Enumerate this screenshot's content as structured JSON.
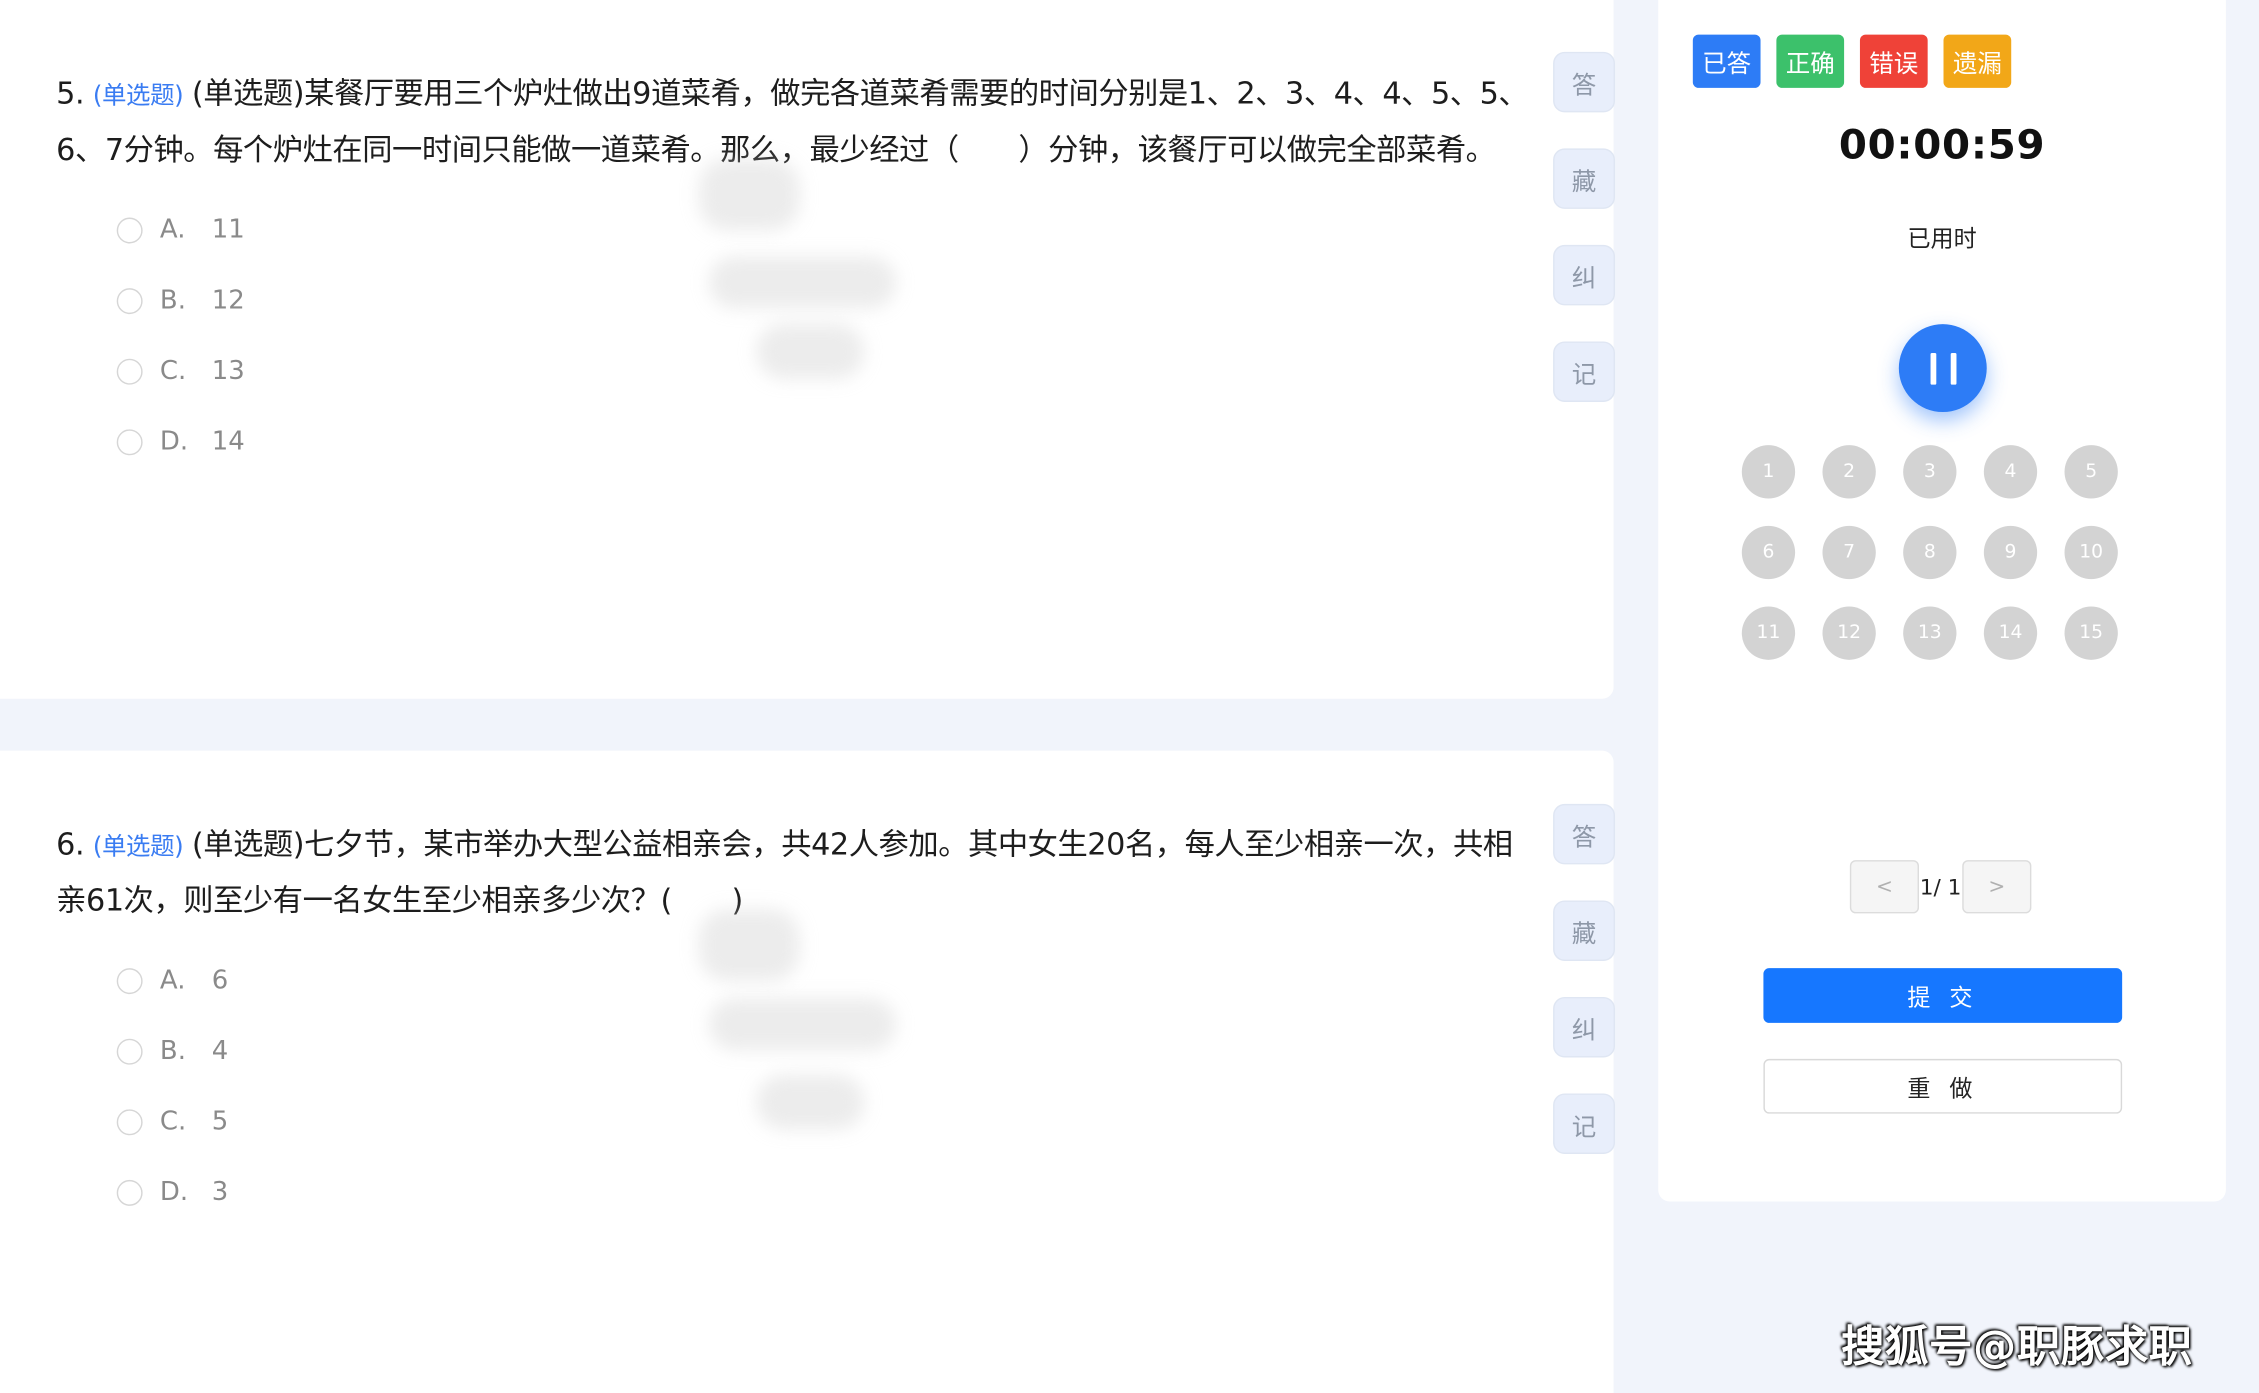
{
  "questions": [
    {
      "number": "5.",
      "tag": "(单选题)",
      "text": "(单选题)某餐厅要用三个炉灶做出9道菜肴，做完各道菜肴需要的时间分别是1、2、3、4、4、5、5、6、7分钟。每个炉灶在同一时间只能做一道菜肴。那么，最少经过（　　）分钟，该餐厅可以做完全部菜肴。",
      "options": [
        {
          "letter": "A.",
          "value": "11"
        },
        {
          "letter": "B.",
          "value": "12"
        },
        {
          "letter": "C.",
          "value": "13"
        },
        {
          "letter": "D.",
          "value": "14"
        }
      ]
    },
    {
      "number": "6.",
      "tag": "(单选题)",
      "text": "(单选题)七夕节，某市举办大型公益相亲会，共42人参加。其中女生20名，每人至少相亲一次，共相亲61次，则至少有一名女生至少相亲多少次？(　　)",
      "options": [
        {
          "letter": "A.",
          "value": "6"
        },
        {
          "letter": "B.",
          "value": "4"
        },
        {
          "letter": "C.",
          "value": "5"
        },
        {
          "letter": "D.",
          "value": "3"
        }
      ]
    }
  ],
  "tools": [
    "答",
    "藏",
    "纠",
    "记"
  ],
  "panel": {
    "legend": [
      {
        "label": "已答",
        "color": "#2d7cf6"
      },
      {
        "label": "正确",
        "color": "#3cc16b"
      },
      {
        "label": "错误",
        "color": "#ef4238"
      },
      {
        "label": "遗漏",
        "color": "#f2a718"
      }
    ],
    "timer": "00:00:59",
    "timer_label": "已用时",
    "numbers": [
      "1",
      "2",
      "3",
      "4",
      "5",
      "6",
      "7",
      "8",
      "9",
      "10",
      "11",
      "12",
      "13",
      "14",
      "15"
    ],
    "pager": {
      "prev": "<",
      "text": "1/ 1",
      "next": ">"
    },
    "submit_label": "提 交",
    "redo_label": "重 做"
  },
  "brand": "搜狐号@职豚求职"
}
